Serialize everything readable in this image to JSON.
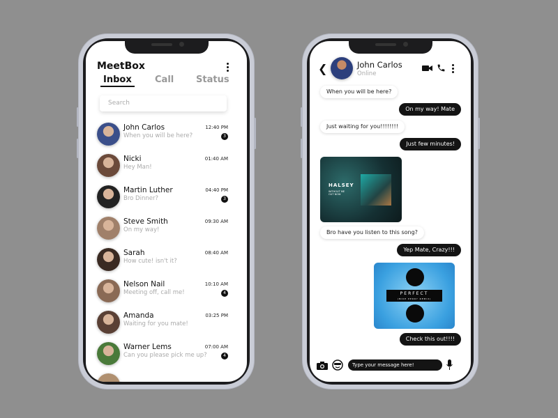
{
  "inbox": {
    "app_title": "MeetBox",
    "tabs": [
      {
        "label": "Inbox",
        "active": true
      },
      {
        "label": "Call",
        "active": false
      },
      {
        "label": "Status",
        "active": false
      }
    ],
    "search_placeholder": "Search",
    "contacts": [
      {
        "name": "John Carlos",
        "preview": "When you will be here?",
        "time": "12:40 PM",
        "unread": "3",
        "avatar_color": "#3b4f8a"
      },
      {
        "name": "Nicki",
        "preview": "Hey Man!",
        "time": "01:40 AM",
        "unread": "",
        "avatar_color": "#6b4a3a"
      },
      {
        "name": "Martin Luther",
        "preview": "Bro Dinner?",
        "time": "04:40 PM",
        "unread": "3",
        "avatar_color": "#222222"
      },
      {
        "name": "Steve Smith",
        "preview": "On my way!",
        "time": "09:30 AM",
        "unread": "",
        "avatar_color": "#a0806a"
      },
      {
        "name": "Sarah",
        "preview": "How cute! isn't it?",
        "time": "08:40 AM",
        "unread": "",
        "avatar_color": "#3a2a22"
      },
      {
        "name": "Nelson Nail",
        "preview": "Meeting off, call me!",
        "time": "10:10 AM",
        "unread": "4",
        "avatar_color": "#8a6a55"
      },
      {
        "name": "Amanda",
        "preview": "Waiting for you mate!",
        "time": "03:25 PM",
        "unread": "",
        "avatar_color": "#5a4035"
      },
      {
        "name": "Warner Lems",
        "preview": "Can you please pick me up?",
        "time": "07:00 AM",
        "unread": "4",
        "avatar_color": "#4a7a3a"
      }
    ]
  },
  "chat": {
    "contact_name": "John Carlos",
    "status": "Online",
    "icons": [
      "back-arrow-icon",
      "video-call-icon",
      "phone-icon",
      "more-vertical-icon",
      "camera-icon",
      "emoji-icon",
      "microphone-icon"
    ],
    "messages": [
      {
        "type": "text",
        "dir": "in",
        "text": "When you will be here?"
      },
      {
        "type": "text",
        "dir": "out",
        "text": "On my way! Mate"
      },
      {
        "type": "text",
        "dir": "in",
        "text": "Just waiting for you!!!!!!!!"
      },
      {
        "type": "text",
        "dir": "out",
        "text": "Just few minutes!"
      },
      {
        "type": "image",
        "dir": "in",
        "album": "HALSEY",
        "subtitle": "WITHOUT ME",
        "caption": "OUT NOW"
      },
      {
        "type": "text",
        "dir": "in",
        "text": "Bro have you listen to this song?"
      },
      {
        "type": "text",
        "dir": "out",
        "text": "Yep Mate, Crazy!!!"
      },
      {
        "type": "image",
        "dir": "out",
        "album": "PERFECT",
        "subtitle": "(MIKE PERRY REMIX)"
      },
      {
        "type": "text",
        "dir": "out",
        "text": "Check this out!!!!"
      }
    ],
    "input_placeholder": "Type your message here!"
  }
}
